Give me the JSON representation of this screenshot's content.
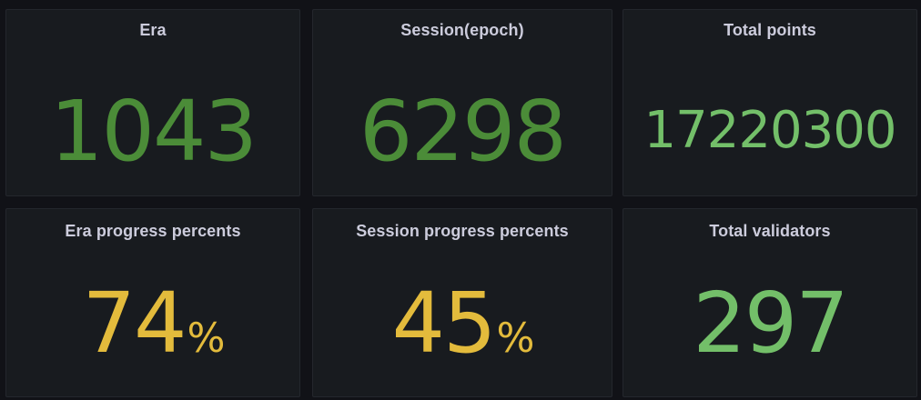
{
  "colors": {
    "green_dark": "#4b8c38",
    "green_light": "#73bf69",
    "yellow": "#e3bb3c",
    "panel_bg": "#181b1f",
    "title": "#ccccdc"
  },
  "panels": [
    {
      "title": "Era",
      "value": "1043",
      "unit": "",
      "color": "#4b8c38"
    },
    {
      "title": "Session(epoch)",
      "value": "6298",
      "unit": "",
      "color": "#4b8c38"
    },
    {
      "title": "Total points",
      "value": "17220300",
      "unit": "",
      "color": "#73bf69"
    },
    {
      "title": "Era progress percents",
      "value": "74",
      "unit": "%",
      "color": "#e3bb3c"
    },
    {
      "title": "Session progress percents",
      "value": "45",
      "unit": "%",
      "color": "#e3bb3c"
    },
    {
      "title": "Total validators",
      "value": "297",
      "unit": "",
      "color": "#73bf69"
    }
  ]
}
